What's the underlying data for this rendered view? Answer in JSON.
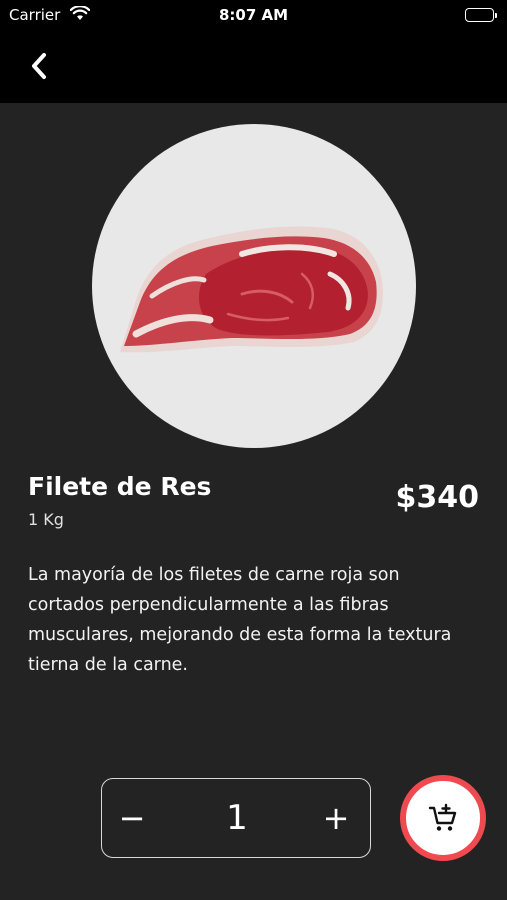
{
  "status_bar": {
    "carrier": "Carrier",
    "time": "8:07 AM"
  },
  "product": {
    "name": "Filete de Res",
    "weight": "1 Kg",
    "price": "$340",
    "description": "La mayoría de los filetes de carne roja son cortados perpendicularmente a las fibras musculares, mejorando de esta forma la textura tierna de la carne.",
    "image_icon": "beef-steak-image"
  },
  "quantity": {
    "minus_label": "−",
    "value": "1",
    "plus_label": "+"
  },
  "icons": {
    "back": "chevron-left-icon",
    "add_to_cart": "cart-plus-icon"
  },
  "colors": {
    "background": "#232323",
    "header": "#000000",
    "accent": "#ee4a50",
    "image_background": "#e8e8e8"
  }
}
